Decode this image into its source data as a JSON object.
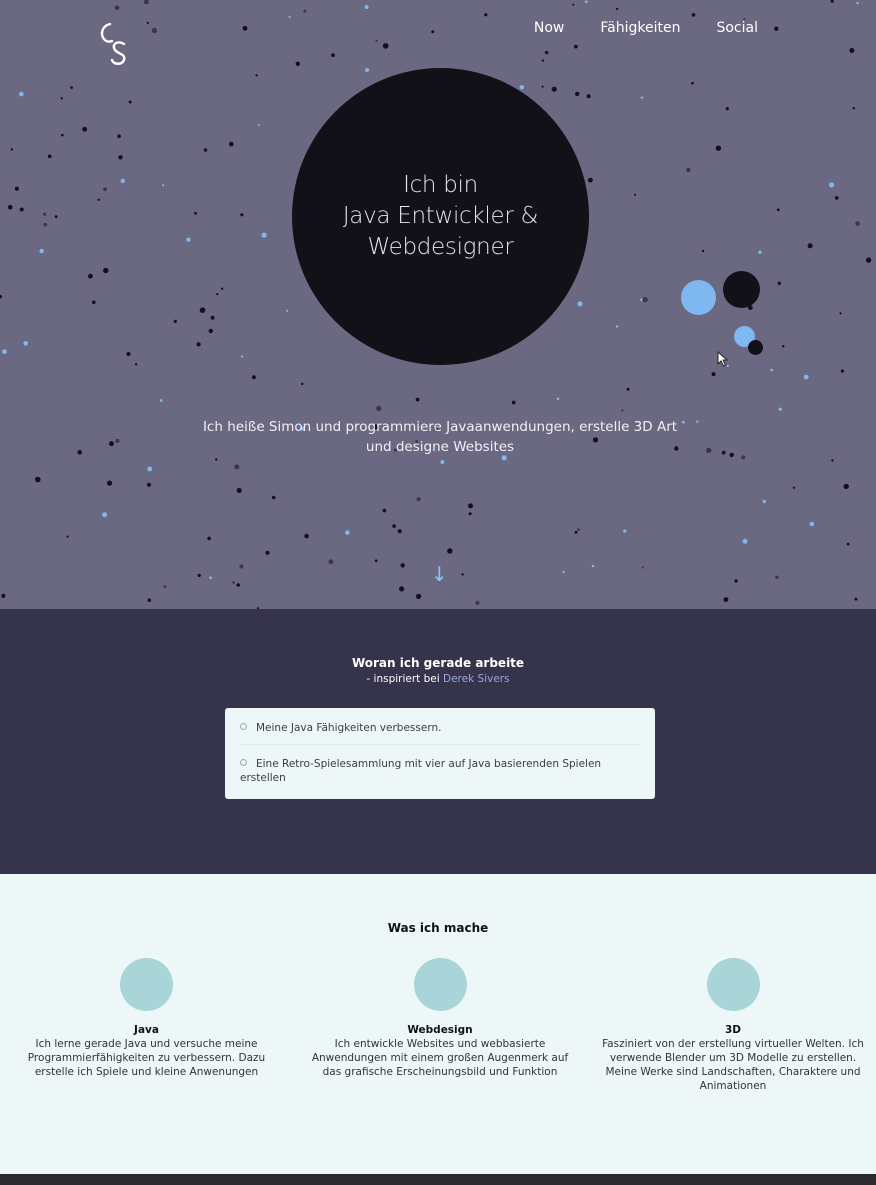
{
  "header": {
    "logo_text": "CS",
    "nav": [
      "Now",
      "Fähigkeiten",
      "Social"
    ]
  },
  "hero": {
    "headline_lines": [
      "Ich bin",
      "Java Entwickler &",
      "Webdesigner"
    ],
    "intro": "Ich heiße Simon und programmiere Javaanwendungen, erstelle 3D Art und designe Websites",
    "scroll_arrow": "↓"
  },
  "now": {
    "title": "Woran ich gerade arbeite",
    "subtitle_prefix": "- inspiriert bei ",
    "subtitle_link": "Derek Sivers",
    "items": [
      "Meine Java Fähigkeiten verbessern.",
      "Eine Retro-Spielesammlung mit vier auf Java basierenden Spielen erstellen"
    ]
  },
  "what": {
    "title": "Was ich mache",
    "columns": [
      {
        "title": "Java",
        "text": "Ich lerne gerade Java und versuche meine Programmierfähigkeiten zu verbessern. Dazu erstelle ich Spiele und kleine Anwenungen"
      },
      {
        "title": "Webdesign",
        "text": "Ich entwickle Websites und webbasierte Anwendungen mit einem großen Augenmerk auf das grafische Erscheinungsbild und Funktion"
      },
      {
        "title": "3D",
        "text": "Fasziniert von der erstellung virtueller Welten. Ich verwende Blender um 3D Modelle zu erstellen. Meine Werke sind Landschaften, Charaktere und Animationen"
      }
    ]
  },
  "colors": {
    "hero_bg": "#6b6882",
    "now_bg": "#35344b",
    "light_bg": "#eef7f8",
    "accent_blue": "#7fb7f0",
    "dark_circle": "#121118",
    "link": "#9aa6e6"
  }
}
